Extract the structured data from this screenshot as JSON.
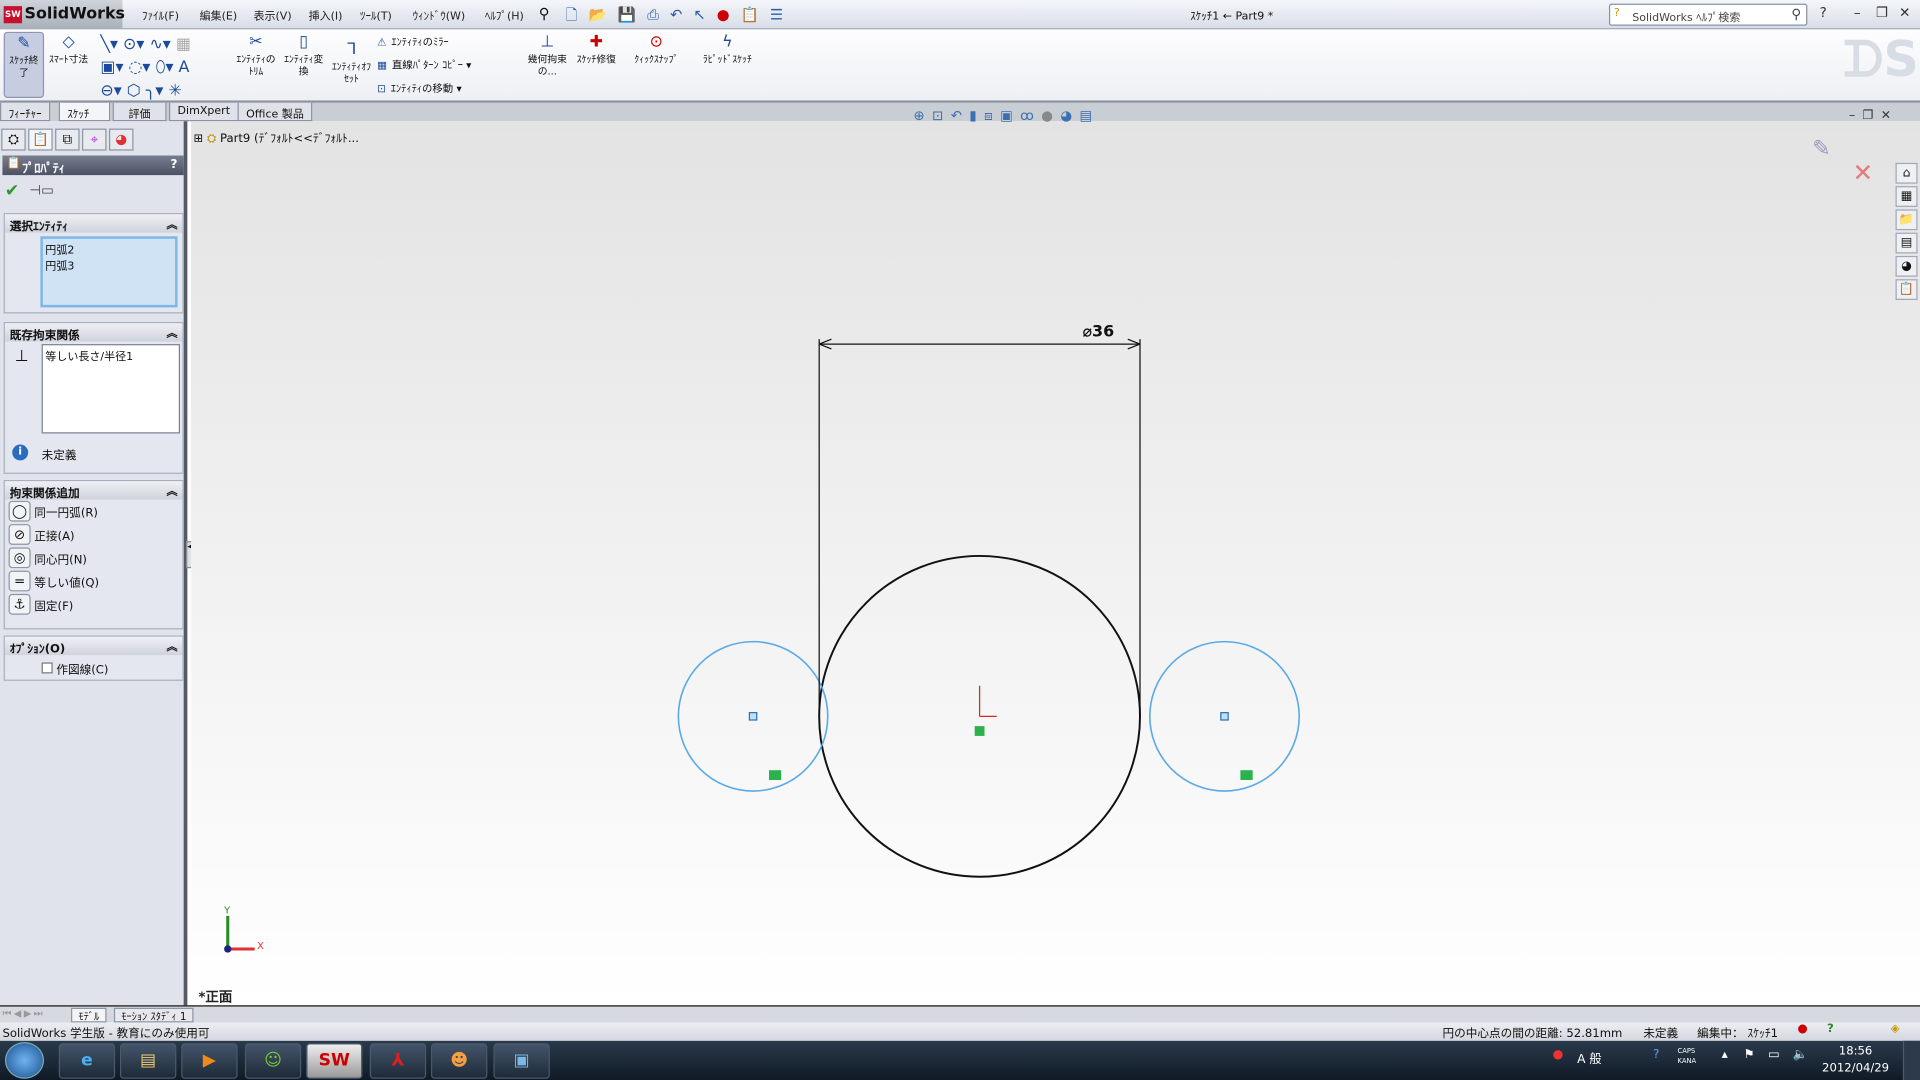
{
  "app": {
    "name": "SolidWorks",
    "document_title": "ｽｹｯﾁ1 ← Part9 *",
    "help_search_placeholder": "SolidWorks ﾍﾙﾌﾟ検索"
  },
  "menu": [
    "ﾌｧｲﾙ(F)",
    "編集(E)",
    "表示(V)",
    "挿入(I)",
    "ﾂｰﾙ(T)",
    "ｳｨﾝﾄﾞｳ(W)",
    "ﾍﾙﾌﾟ(H)"
  ],
  "ribbon": {
    "exit_sketch": "ｽｹｯﾁ終了",
    "smart_dim": "ｽﾏｰﾄ寸法",
    "trim": "ｴﾝﾃｨﾃｨのﾄﾘﾑ",
    "convert": "ｴﾝﾃｨﾃｨ変換",
    "offset": "ｴﾝﾃｨﾃｨｵﾌｾｯﾄ",
    "mirror": "ｴﾝﾃｨﾃｨのﾐﾗｰ",
    "linear_pattern": "直線ﾊﾟﾀｰﾝ ｺﾋﾟｰ",
    "move": "ｴﾝﾃｨﾃｨの移動",
    "relations": "幾何拘束の...",
    "repair": "ｽｹｯﾁ修復",
    "quick_snaps": "ｸｨｯｸｽﾅｯﾌﾟ",
    "rapid_sketch": "ﾗﾋﾟｯﾄﾞｽｹｯﾁ"
  },
  "command_tabs": [
    "ﾌｨｰﾁｬｰ",
    "ｽｹｯﾁ",
    "評価",
    "DimXpert",
    "Office 製品"
  ],
  "active_command_tab": "ｽｹｯﾁ",
  "property_manager": {
    "title": "ﾌﾟﾛﾊﾟﾃｨ",
    "help": "?",
    "selected_entities": {
      "label": "選択ｴﾝﾃｨﾃｨ",
      "items": [
        "円弧2",
        "円弧3"
      ]
    },
    "existing_relations": {
      "label": "既存拘束関係",
      "items": [
        "等しい長さ/半径1"
      ],
      "status": "未定義"
    },
    "add_relations": {
      "label": "拘束関係追加",
      "items": [
        {
          "label": "同一円弧(R)",
          "icon": "coradial-icon"
        },
        {
          "label": "正接(A)",
          "icon": "tangent-icon"
        },
        {
          "label": "同心円(N)",
          "icon": "concentric-icon"
        },
        {
          "label": "等しい値(Q)",
          "icon": "equal-icon"
        },
        {
          "label": "固定(F)",
          "icon": "fix-icon"
        }
      ]
    },
    "options": {
      "label": "ｵﾌﾟｼｮﾝ(O)",
      "construction": {
        "label": "作図線(C)",
        "checked": false
      }
    }
  },
  "canvas": {
    "tree_root": "Part9  (ﾃﾞﾌｫﾙﾄ<<ﾃﾞﾌｫﾙﾄ...",
    "dimension": "⌀36",
    "view_name": "*正面",
    "axis_x": "X",
    "axis_y": "Y",
    "sketch_color_selected": "#5aa9e6",
    "sketch_color": "#111111"
  },
  "bottom_tabs": [
    "ﾓﾃﾞﾙ",
    "ﾓｰｼｮﾝ ｽﾀﾃﾞｨ 1"
  ],
  "status": {
    "left": "SolidWorks 学生版 - 教育にのみ使用可",
    "measure": "円の中心点の間の距離:  52.81mm",
    "state": "未定義",
    "editing": "編集中： ｽｹｯﾁ1"
  },
  "taskbar": {
    "time": "18:56",
    "date": "2012/04/29",
    "ime": "A 般",
    "caps": "CAPS",
    "kana": "KANA"
  }
}
